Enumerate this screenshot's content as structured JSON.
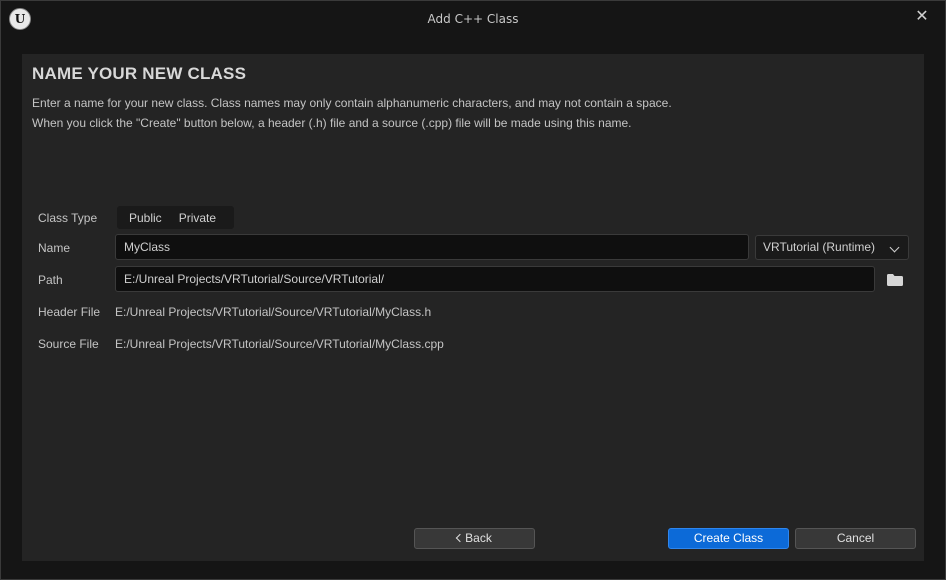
{
  "window": {
    "title": "Add C++ Class",
    "logo_text": "U",
    "close_glyph": "✕"
  },
  "main": {
    "heading": "NAME YOUR NEW CLASS",
    "description_line1": "Enter a name for your new class. Class names may only contain alphanumeric characters, and may not contain a space.",
    "description_line2": "When you click the \"Create\" button below, a header (.h) file and a source (.cpp) file will be made using this name."
  },
  "form": {
    "class_type_label": "Class Type",
    "class_type_options": [
      "Public",
      "Private"
    ],
    "name_label": "Name",
    "name_value": "MyClass",
    "module_dropdown": "VRTutorial (Runtime)",
    "path_label": "Path",
    "path_value": "E:/Unreal Projects/VRTutorial/Source/VRTutorial/",
    "header_file_label": "Header File",
    "header_file_value": "E:/Unreal Projects/VRTutorial/Source/VRTutorial/MyClass.h",
    "source_file_label": "Source File",
    "source_file_value": "E:/Unreal Projects/VRTutorial/Source/VRTutorial/MyClass.cpp"
  },
  "buttons": {
    "back": "Back",
    "create": "Create Class",
    "cancel": "Cancel"
  },
  "colors": {
    "accent": "#0c6ad8",
    "panel": "#242424",
    "background": "#151515"
  },
  "icons": {
    "folder": "folder-icon",
    "chevron": "chevron-down-icon",
    "close": "close-icon"
  }
}
